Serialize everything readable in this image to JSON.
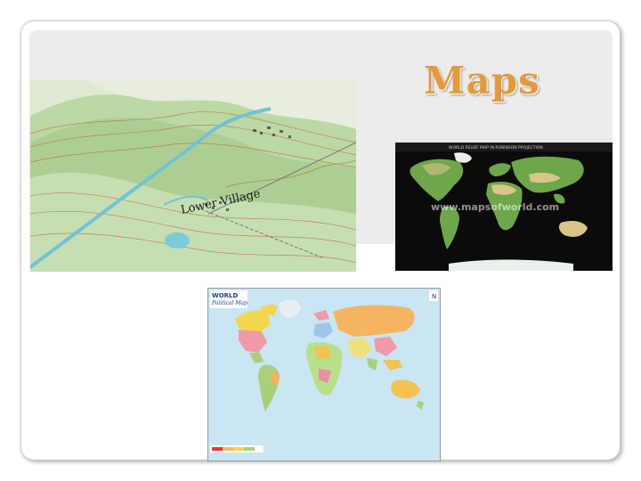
{
  "slide": {
    "title": "Maps"
  },
  "images": {
    "topographic_map": {
      "place_label": "Lower Village",
      "colors": {
        "land": "#c8dfb6",
        "relief": "#8fae7b",
        "water": "#6fc3d6",
        "contour": "#b46a3c"
      }
    },
    "world_relief_map": {
      "heading": "WORLD RELIEF MAP IN ROBINSON PROJECTION",
      "watermark": "www.mapsofworld.com",
      "colors": {
        "background": "#0b0b0b",
        "land": "#6ea64a",
        "desert": "#d9c58a"
      }
    },
    "world_political_map": {
      "heading_line1": "WORLD",
      "heading_line2": "Political Map",
      "colors": {
        "ocean": "#c9e6f2",
        "frame": "#9a9a9a"
      }
    }
  }
}
